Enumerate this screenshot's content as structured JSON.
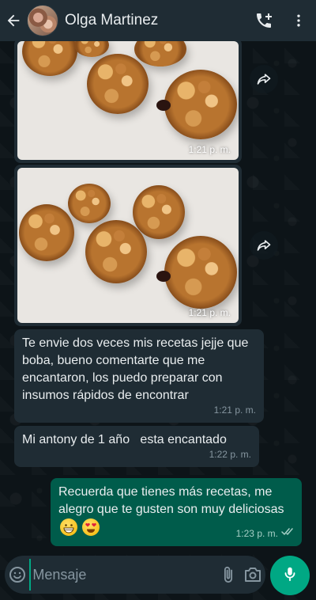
{
  "header": {
    "contact_name": "Olga Martinez",
    "icons": [
      "back-arrow-icon",
      "add-call-icon",
      "more-vertical-icon"
    ]
  },
  "messages": [
    {
      "type": "image",
      "direction": "incoming",
      "time": "1:21 p. m.",
      "image_alt": "Galletas de avena con pasas"
    },
    {
      "type": "image",
      "direction": "incoming",
      "time": "1:21 p. m.",
      "image_alt": "Galletas de avena con pasas"
    },
    {
      "type": "text",
      "direction": "incoming",
      "text": "Te envie dos veces mis recetas jejje que boba, bueno comentarte que me encantaron, los puedo preparar con insumos rápidos de encontrar",
      "time": "1:21 p. m."
    },
    {
      "type": "text",
      "direction": "incoming",
      "text": "Mi antony de 1 año   esta encantado",
      "time": "1:22 p. m."
    },
    {
      "type": "text",
      "direction": "outgoing",
      "text": "Recuerda que tienes más recetas, me alegro que te gusten son muy deliciosas",
      "time": "1:23 p. m.",
      "status": "read"
    }
  ],
  "composer": {
    "placeholder": "Mensaje"
  },
  "colors": {
    "header_bg": "#1f2c34",
    "incoming_bubble": "#1f2c34",
    "outgoing_bubble": "#005c4b",
    "accent": "#00a884",
    "chat_bg": "#0b141a"
  }
}
